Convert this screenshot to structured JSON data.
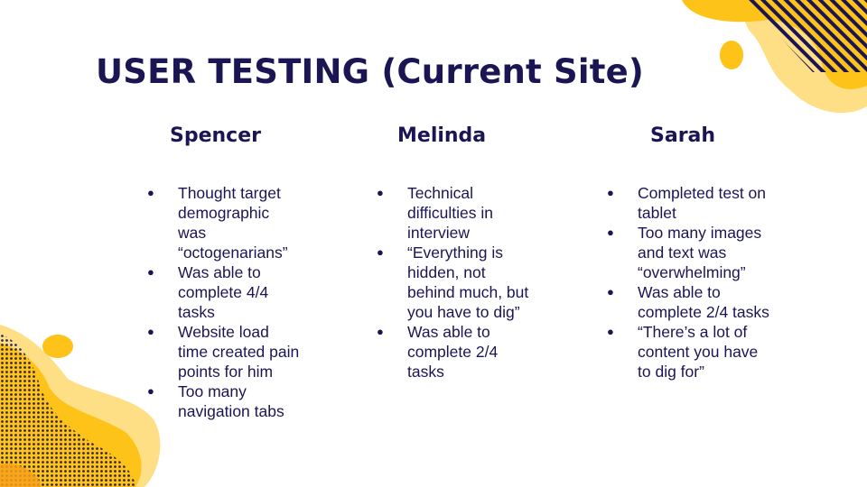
{
  "slide": {
    "title": "USER TESTING (Current Site)",
    "colors": {
      "heading": "#1b1554",
      "accent_yellow": "#fdc318",
      "accent_light_yellow": "#fedf86",
      "accent_orange": "#f8a11a"
    },
    "columns": [
      {
        "name": "Spencer",
        "bullets": [
          "Thought target demographic was “octogenarians”",
          "Was able to complete 4/4 tasks",
          "Website load time created pain points for him",
          "Too many navigation tabs"
        ]
      },
      {
        "name": "Melinda",
        "bullets": [
          "Technical difficulties in interview",
          "“Everything is hidden, not behind much, but you have to dig”",
          "Was able to complete 2/4 tasks"
        ]
      },
      {
        "name": "Sarah",
        "bullets": [
          "Completed test on tablet",
          "Too many images and text was “overwhelming”",
          "Was able to complete 2/4 tasks",
          "“There’s a lot of content you have to dig for”"
        ]
      }
    ],
    "bullet_glyph": "●"
  }
}
